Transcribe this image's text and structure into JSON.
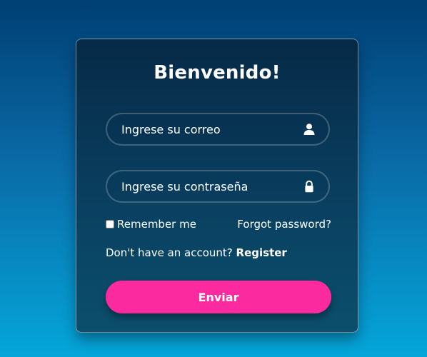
{
  "login": {
    "title": "Bienvenido!",
    "email_placeholder": "Ingrese su correo",
    "email_value": "",
    "password_placeholder": "Ingrese su contraseña",
    "password_value": "",
    "remember_label": "Remember me",
    "remember_checked": false,
    "forgot_label": "Forgot password?",
    "signup_prompt": "Don't have an account? ",
    "signup_link": "Register",
    "submit_label": "Enviar"
  },
  "icons": {
    "email_icon": "user-icon",
    "password_icon": "lock-icon"
  },
  "colors": {
    "bg_top": "#003f74",
    "bg_bottom": "#04a6da",
    "card_top": "#062a47",
    "card_bottom": "#0b4f6c",
    "accent": "#fb2b9f",
    "text": "#ffffff"
  }
}
